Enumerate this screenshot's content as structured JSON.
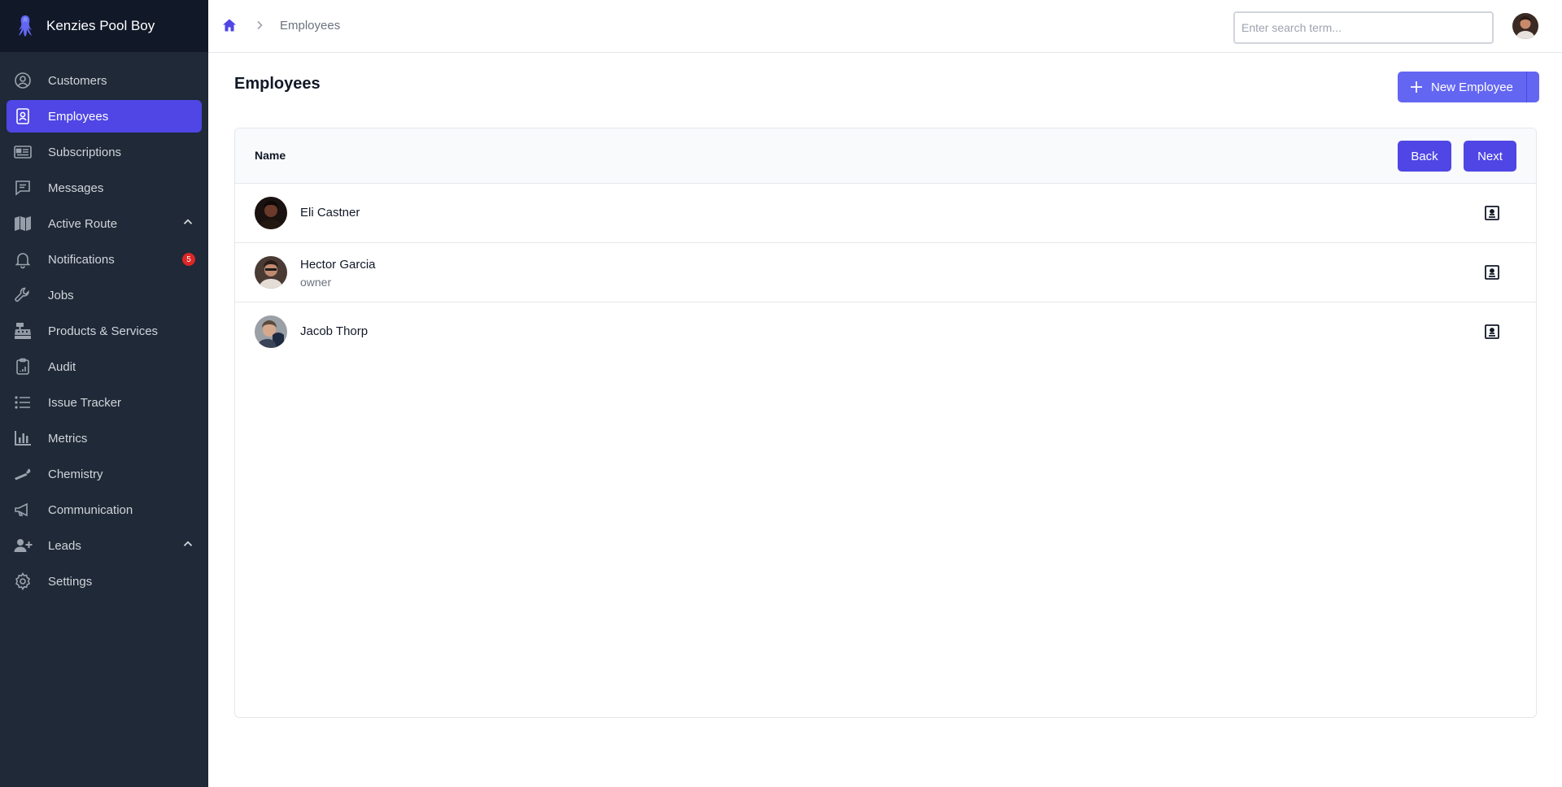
{
  "app": {
    "name": "Kenzies Pool Boy"
  },
  "sidebar": {
    "items": [
      {
        "label": "Customers",
        "icon": "user-circle-icon"
      },
      {
        "label": "Employees",
        "icon": "id-badge-icon",
        "active": true
      },
      {
        "label": "Subscriptions",
        "icon": "id-card-icon"
      },
      {
        "label": "Messages",
        "icon": "chat-bubble-icon"
      },
      {
        "label": "Active Route",
        "icon": "map-icon",
        "expandable": true
      },
      {
        "label": "Notifications",
        "icon": "bell-icon",
        "badge": "5"
      },
      {
        "label": "Jobs",
        "icon": "wrench-icon"
      },
      {
        "label": "Products & Services",
        "icon": "cash-register-icon"
      },
      {
        "label": "Audit",
        "icon": "clipboard-icon"
      },
      {
        "label": "Issue Tracker",
        "icon": "list-icon"
      },
      {
        "label": "Metrics",
        "icon": "bar-chart-icon"
      },
      {
        "label": "Chemistry",
        "icon": "pipette-icon"
      },
      {
        "label": "Communication",
        "icon": "megaphone-icon"
      },
      {
        "label": "Leads",
        "icon": "user-plus-icon",
        "expandable": true
      },
      {
        "label": "Settings",
        "icon": "gear-icon"
      }
    ]
  },
  "header": {
    "breadcrumb": "Employees",
    "search": {
      "placeholder": "Enter search term...",
      "value": ""
    }
  },
  "main": {
    "title": "Employees",
    "new_button": "New Employee",
    "table": {
      "column": "Name",
      "back_label": "Back",
      "next_label": "Next",
      "rows": [
        {
          "name": "Eli Castner",
          "role": ""
        },
        {
          "name": "Hector Garcia",
          "role": "owner"
        },
        {
          "name": "Jacob Thorp",
          "role": ""
        }
      ]
    }
  },
  "colors": {
    "sidebar_bg": "#1f2937",
    "brand_bg": "#111827",
    "accent": "#4f46e5",
    "badge": "#dc2626"
  }
}
